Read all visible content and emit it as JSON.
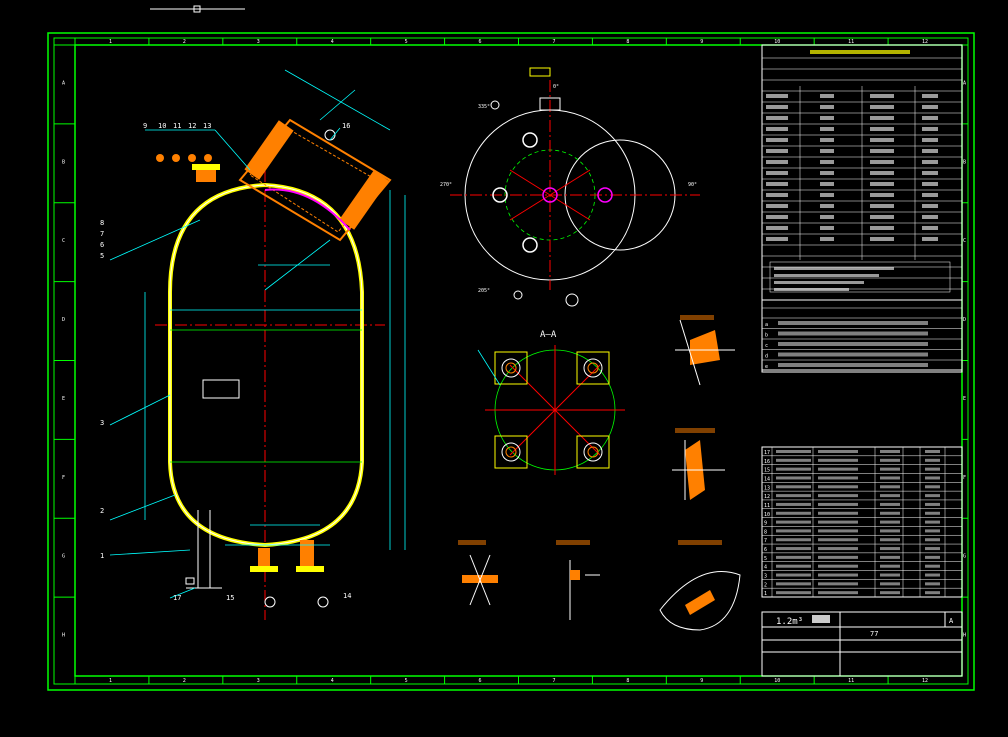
{
  "section_label": "A—A",
  "callouts_left": [
    "9",
    "10",
    "11",
    "12",
    "13"
  ],
  "callouts_side": [
    "8",
    "7",
    "6",
    "5"
  ],
  "callouts_other": [
    "16",
    "3",
    "2",
    "1",
    "17",
    "15",
    "14"
  ],
  "angles": [
    "335°",
    "270°",
    "90°",
    "205°",
    "0°"
  ],
  "title_block": {
    "capacity": "1.2m³",
    "drawing_no": "77",
    "rev": "A"
  },
  "parts_list": [
    {
      "no": "17"
    },
    {
      "no": "16"
    },
    {
      "no": "15"
    },
    {
      "no": "14"
    },
    {
      "no": "13"
    },
    {
      "no": "12"
    },
    {
      "no": "11"
    },
    {
      "no": "10"
    },
    {
      "no": "9"
    },
    {
      "no": "8"
    },
    {
      "no": "7"
    },
    {
      "no": "6"
    },
    {
      "no": "5"
    },
    {
      "no": "4"
    },
    {
      "no": "3"
    },
    {
      "no": "2"
    },
    {
      "no": "1"
    }
  ],
  "nozzle_table": [
    {
      "id": "a"
    },
    {
      "id": "b"
    },
    {
      "id": "c"
    },
    {
      "id": "d"
    },
    {
      "id": "e"
    }
  ],
  "border_columns": [
    "1",
    "2",
    "3",
    "4",
    "5",
    "6",
    "7",
    "8",
    "9",
    "10",
    "11",
    "12"
  ],
  "border_rows": [
    "A",
    "B",
    "C",
    "D",
    "E",
    "F",
    "G",
    "H"
  ],
  "colors": {
    "background": "#000000",
    "border": "#00ff00",
    "outline": "#ffffff",
    "center_line": "#ff0000",
    "dimension": "#00ffff",
    "hatch": "#ff8000",
    "text_yellow": "#ffff00",
    "magenta": "#ff00ff"
  }
}
